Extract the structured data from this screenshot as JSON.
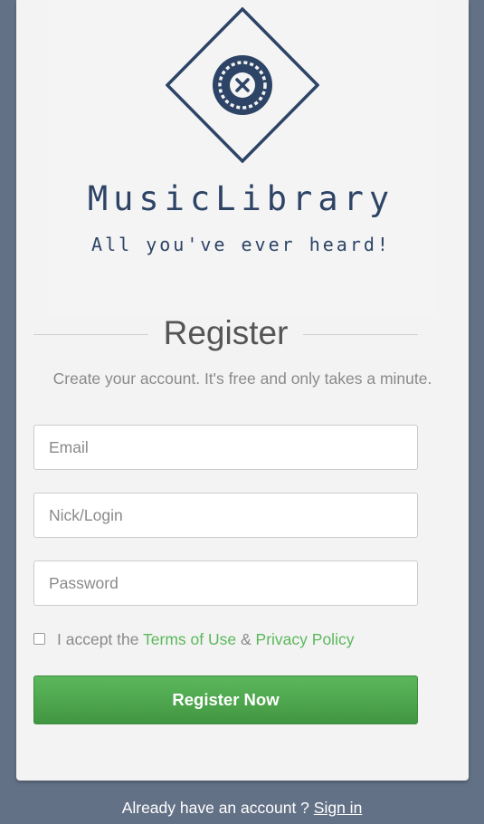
{
  "brand": {
    "name": "MusicLibrary",
    "tagline": "All you've ever heard!",
    "logo_icon": "vinyl-record-x-icon",
    "color": "#2d4466"
  },
  "register": {
    "heading": "Register",
    "subtitle": "Create your account. It's free and only takes a minute.",
    "email_placeholder": "Email",
    "login_placeholder": "Nick/Login",
    "password_placeholder": "Password",
    "terms_prefix": "I accept the",
    "terms_link": "Terms of Use",
    "terms_amp": "&",
    "privacy_link": "Privacy Policy",
    "terms_checked": false,
    "submit_label": "Register Now",
    "accent_color": "#5cb85c"
  },
  "footer": {
    "prompt": "Already have an account ?",
    "signin_link": "Sign in"
  },
  "colors": {
    "page_background": "#637186",
    "card_background": "#f3f3f3"
  }
}
